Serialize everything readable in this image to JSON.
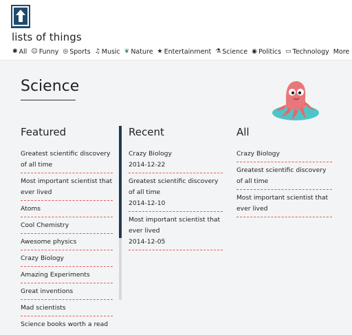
{
  "site": {
    "title": "lists of things"
  },
  "nav": {
    "items": [
      {
        "label": "All",
        "icon": "asterisk-icon"
      },
      {
        "label": "Funny",
        "icon": "smiley-icon"
      },
      {
        "label": "Sports",
        "icon": "ball-icon"
      },
      {
        "label": "Music",
        "icon": "music-note-icon"
      },
      {
        "label": "Nature",
        "icon": "leaf-icon"
      },
      {
        "label": "Entertainment",
        "icon": "star-icon"
      },
      {
        "label": "Science",
        "icon": "flask-icon"
      },
      {
        "label": "Politics",
        "icon": "eye-icon"
      },
      {
        "label": "Technology",
        "icon": "laptop-icon"
      },
      {
        "label": "More >>",
        "icon": ""
      }
    ]
  },
  "page": {
    "title": "Science"
  },
  "columns": {
    "featured": {
      "title": "Featured",
      "items": [
        "Greatest scientific discovery of all time",
        "Most important scientist that ever lived",
        "Atoms",
        "Cool Chemistry",
        "Awesome physics",
        "Crazy Biology",
        "Amazing Experiments",
        "Great inventions",
        "Mad scientists",
        "Science books worth a read"
      ]
    },
    "recent": {
      "title": "Recent",
      "items": [
        {
          "title": "Crazy Biology",
          "date": "2014-12-22"
        },
        {
          "title": "Greatest scientific discovery of all time",
          "date": "2014-12-10"
        },
        {
          "title": "Most important scientist that ever lived",
          "date": "2014-12-05"
        }
      ]
    },
    "all": {
      "title": "All",
      "items": [
        "Crazy Biology",
        "Greatest scientific discovery of all time",
        "Most important scientist that ever lived"
      ]
    }
  },
  "colors": {
    "accent_dashed": "#e35a5a",
    "logo_bg": "#1f4a6e",
    "mascot": "#e9777a",
    "mascot_base": "#4fc4c8"
  }
}
